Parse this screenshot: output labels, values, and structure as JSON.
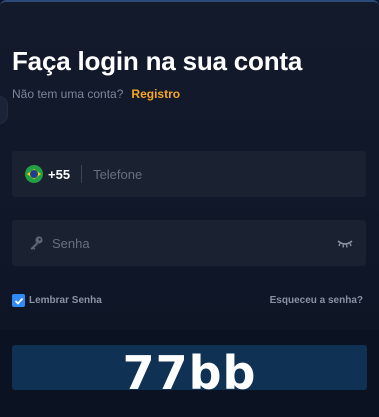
{
  "header": {
    "title": "Faça login na sua conta",
    "no_account_text": "Não tem uma conta?",
    "register_link": "Registro"
  },
  "phone_field": {
    "country_flag": "brazil-flag-icon",
    "country_code": "+55",
    "placeholder": "Telefone"
  },
  "password_field": {
    "icon": "key-icon",
    "placeholder": "Senha",
    "toggle_icon": "eye-closed-icon"
  },
  "options": {
    "remember_label": "Lembrar Senha",
    "remember_checked": true,
    "forgot_link": "Esqueceu a senha?"
  },
  "watermark": {
    "text": "77bb"
  },
  "colors": {
    "accent": "#f5a623",
    "checkbox": "#2f8af3",
    "field_bg": "#1a2131",
    "button_bg": "#0f3154"
  }
}
